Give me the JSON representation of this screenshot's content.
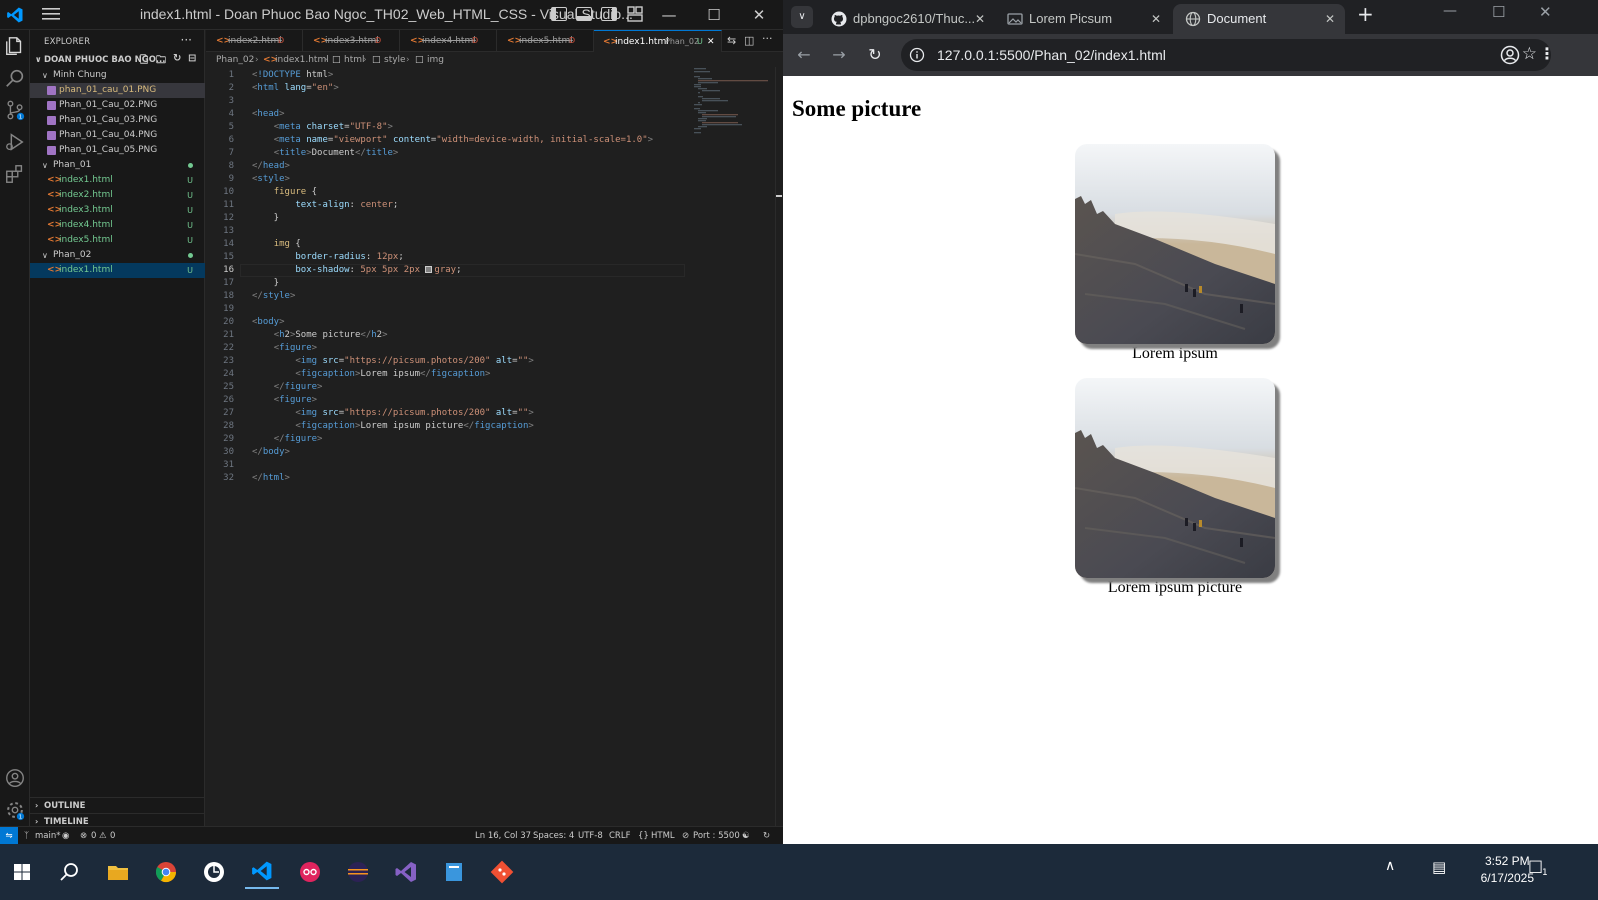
{
  "vscode": {
    "window_title": "index1.html - Doan Phuoc Bao Ngoc_TH02_Web_HTML_CSS - Visual Studio...",
    "explorer": {
      "header": "EXPLORER",
      "root": "DOAN PHUOC BAO NGO...",
      "folders": [
        {
          "name": "Minh Chung",
          "files": [
            "phan_01_cau_01.PNG",
            "Phan_01_Cau_02.PNG",
            "Phan_01_Cau_03.PNG",
            "Phan_01_Cau_04.PNG",
            "Phan_01_Cau_05.PNG"
          ]
        },
        {
          "name": "Phan_01",
          "files": [
            "index1.html",
            "index2.html",
            "index3.html",
            "index4.html",
            "index5.html"
          ]
        },
        {
          "name": "Phan_02",
          "files": [
            "index1.html"
          ]
        }
      ],
      "status_u": "U",
      "outline": "OUTLINE",
      "timeline": "TIMELINE"
    },
    "tabs": [
      {
        "label": "index2.html",
        "mark": "D"
      },
      {
        "label": "index3.html",
        "mark": "D"
      },
      {
        "label": "index4.html",
        "mark": "D"
      },
      {
        "label": "index5.html",
        "mark": "D"
      },
      {
        "label": "index1.html",
        "sub": "Phan_02",
        "mark": "U"
      }
    ],
    "breadcrumb": [
      "Phan_02",
      "index1.html",
      "html",
      "style",
      "img"
    ],
    "current_line": 16,
    "statusbar": {
      "branch": "main*",
      "problems": "0",
      "warnings": "0",
      "position": "Ln 16, Col 37",
      "spaces": "Spaces: 4",
      "encoding": "UTF-8",
      "eol": "CRLF",
      "language": "HTML",
      "port": "Port : 5500"
    }
  },
  "code_lines": [
    "<!DOCTYPE html>",
    "<html lang=\"en\">",
    "",
    "<head>",
    "    <meta charset=\"UTF-8\">",
    "    <meta name=\"viewport\" content=\"width=device-width, initial-scale=1.0\">",
    "    <title>Document</title>",
    "</head>",
    "<style>",
    "    figure {",
    "        text-align: center;",
    "    }",
    "",
    "    img {",
    "        border-radius: 12px;",
    "        box-shadow: 5px 5px 2px gray;",
    "    }",
    "</style>",
    "",
    "<body>",
    "    <h2>Some picture</h2>",
    "    <figure>",
    "        <img src=\"https://picsum.photos/200\" alt=\"\">",
    "        <figcaption>Lorem ipsum</figcaption>",
    "    </figure>",
    "    <figure>",
    "        <img src=\"https://picsum.photos/200\" alt=\"\">",
    "        <figcaption>Lorem ipsum picture</figcaption>",
    "    </figure>",
    "</body>",
    "",
    "</html>"
  ],
  "browser": {
    "tabs": [
      {
        "label": "dpbngoc2610/Thuc...",
        "icon": "github-icon"
      },
      {
        "label": "Lorem Picsum",
        "icon": "picsum-icon"
      },
      {
        "label": "Document",
        "icon": "globe-icon"
      }
    ],
    "url": "127.0.0.1:5500/Phan_02/index1.html",
    "page": {
      "heading": "Some picture",
      "figures": [
        {
          "caption": "Lorem ipsum"
        },
        {
          "caption": "Lorem ipsum picture"
        }
      ]
    }
  },
  "taskbar": {
    "time": "3:52 PM",
    "date": "6/17/2025",
    "notifications": "1"
  }
}
